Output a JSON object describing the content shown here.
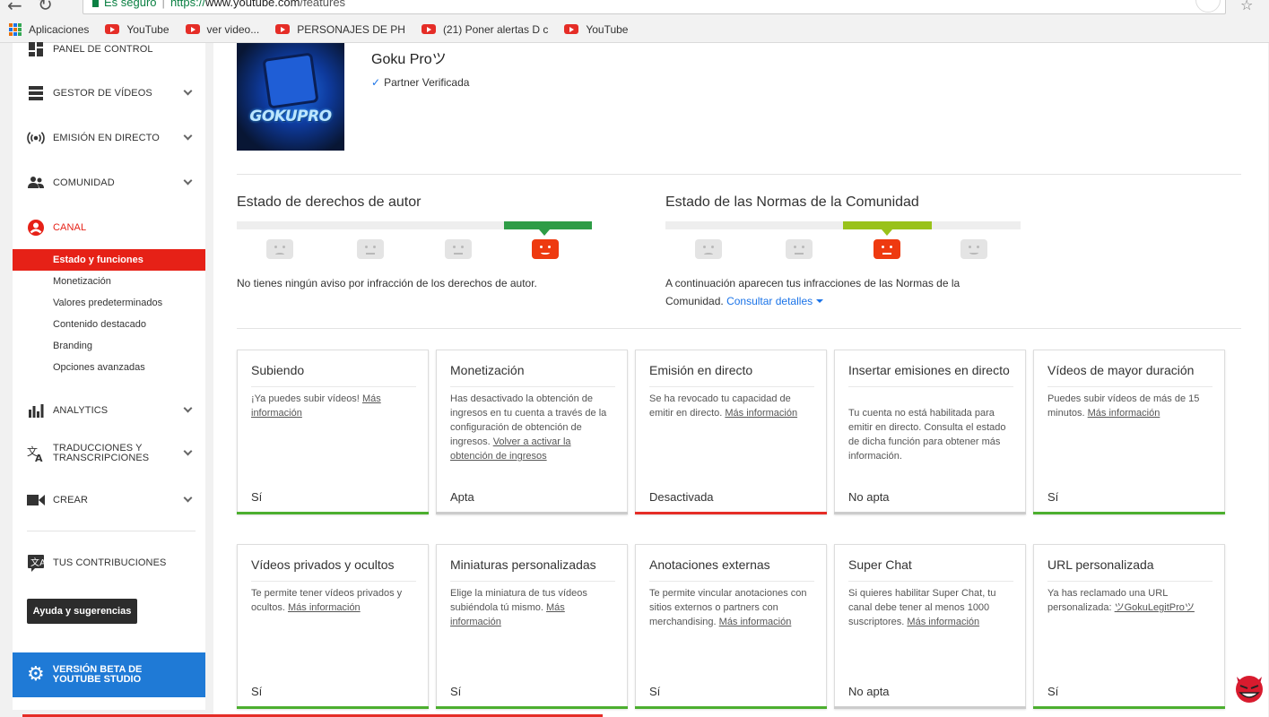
{
  "browser": {
    "secure_label": "Es seguro",
    "url_scheme": "https://",
    "url_host": "www.youtube.com",
    "url_path": "/features",
    "bookmarks": [
      {
        "label": "Aplicaciones",
        "icon": "apps-icon"
      },
      {
        "label": "YouTube",
        "icon": "youtube-icon"
      },
      {
        "label": "ver video...",
        "icon": "youtube-icon"
      },
      {
        "label": "PERSONAJES DE PH",
        "icon": "youtube-icon"
      },
      {
        "label": "(21) Poner alertas D c",
        "icon": "youtube-icon"
      },
      {
        "label": "YouTube",
        "icon": "youtube-icon"
      }
    ]
  },
  "sidebar": {
    "items": [
      {
        "label": "PANEL DE CONTROL",
        "icon": "dashboard-icon"
      },
      {
        "label": "GESTOR DE VÍDEOS",
        "icon": "video-manager-icon"
      },
      {
        "label": "EMISIÓN EN DIRECTO",
        "icon": "live-icon"
      },
      {
        "label": "COMUNIDAD",
        "icon": "community-icon"
      },
      {
        "label": "CANAL",
        "icon": "channel-icon"
      },
      {
        "label": "ANALYTICS",
        "icon": "analytics-icon"
      },
      {
        "label": "TRADUCCIONES Y TRANSCRIPCIONES",
        "icon": "translate-icon"
      },
      {
        "label": "CREAR",
        "icon": "camera-icon"
      },
      {
        "label": "TUS CONTRIBUCIONES",
        "icon": "contributions-icon"
      }
    ],
    "channel_subitems": [
      "Estado y funciones",
      "Monetización",
      "Valores predeterminados",
      "Contenido destacado",
      "Branding",
      "Opciones avanzadas"
    ],
    "help_button": "Ayuda y sugerencias",
    "beta_label": "VERSIÓN BETA DE YOUTUBE STUDIO",
    "accent": "#e62117",
    "beta_color": "#1f7ad6"
  },
  "channel": {
    "name": "Goku Proツ",
    "avatar_text": "GOKUPRO",
    "partner": "Partner Verificada"
  },
  "copyright": {
    "title": "Estado de derechos de autor",
    "text": "No tienes ningún aviso por infracción de los derechos de autor."
  },
  "community": {
    "title": "Estado de las Normas de la Comunidad",
    "text": "A continuación aparecen tus infracciones de las Normas de la Comunidad.",
    "link": "Consultar detalles"
  },
  "features": [
    {
      "title": "Subiendo",
      "text": "¡Ya puedes subir vídeos!",
      "link": "Más información",
      "status": "Sí",
      "color": "#4caf2f"
    },
    {
      "title": "Monetización",
      "text": "Has desactivado la obtención de ingresos en tu cuenta a través de la configuración de obtención de ingresos.",
      "link": "Volver a activar la obtención de ingresos",
      "status": "Apta",
      "color": "#cccccc"
    },
    {
      "title": "Emisión en directo",
      "text": "Se ha revocado tu capacidad de emitir en directo.",
      "link": "Más información",
      "status": "Desactivada",
      "color": "#e52d27"
    },
    {
      "title": "Insertar emisiones en directo",
      "text": "Tu cuenta no está habilitada para emitir en directo. Consulta el estado de dicha función para obtener más información.",
      "link": "",
      "status": "No apta",
      "color": "#cccccc"
    },
    {
      "title": "Vídeos de mayor duración",
      "text": "Puedes subir vídeos de más de 15 minutos.",
      "link": "Más información",
      "status": "Sí",
      "color": "#4caf2f"
    },
    {
      "title": "Vídeos privados y ocultos",
      "text": "Te permite tener vídeos privados y ocultos.",
      "link": "Más información",
      "status": "Sí",
      "color": "#4caf2f"
    },
    {
      "title": "Miniaturas personalizadas",
      "text": "Elige la miniatura de tus vídeos subiéndola tú mismo.",
      "link": "Más información",
      "status": "Sí",
      "color": "#4caf2f"
    },
    {
      "title": "Anotaciones externas",
      "text": "Te permite vincular anotaciones con sitios externos o partners con merchandising.",
      "link": "Más información",
      "status": "Sí",
      "color": "#4caf2f"
    },
    {
      "title": "Super Chat",
      "text": "Si quieres habilitar Super Chat, tu canal debe tener al menos 1000 suscriptores.",
      "link": "Más información",
      "status": "No apta",
      "color": "#cccccc"
    },
    {
      "title": "URL personalizada",
      "text": "Ya has reclamado una URL personalizada:",
      "link": "ツGokuLegitProツ",
      "status": "Sí",
      "color": "#4caf2f"
    }
  ]
}
